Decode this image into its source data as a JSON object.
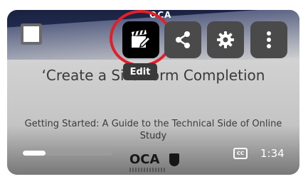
{
  "player": {
    "slide": {
      "title": "‘Create a Site Form Completion",
      "subtitle": "Getting Started: A Guide to the Technical Side of Online Study",
      "logo_text": "OCA"
    },
    "controls": {
      "edit": {
        "icon": "edit-clapperboard-icon",
        "tooltip": "Edit"
      },
      "share": {
        "icon": "share-icon"
      },
      "settings": {
        "icon": "gear-icon"
      },
      "more": {
        "icon": "more-vertical-icon"
      },
      "captions": {
        "icon": "closed-captions-icon",
        "label": "CC"
      },
      "duration": "1:34",
      "progress": 0.25
    },
    "colors": {
      "highlight_ring": "#e0202a",
      "button_bg": "#4a4a4a",
      "active_button_bg": "#000000"
    }
  }
}
